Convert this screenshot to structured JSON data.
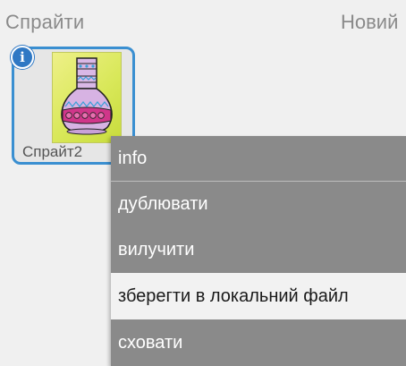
{
  "header": {
    "sprites_label": "Спрайти",
    "new_label": "Новий"
  },
  "sprite": {
    "name": "Спрайт2",
    "info_badge": "i",
    "thumbnail_icon": "vase-icon"
  },
  "context_menu": {
    "items": [
      {
        "label": "info"
      },
      {
        "label": "дублювати"
      },
      {
        "label": "вилучити"
      },
      {
        "label": "зберегти в локальний файл",
        "highlighted": true
      },
      {
        "label": "сховати"
      }
    ]
  },
  "colors": {
    "accent": "#3a8fd1",
    "menu_background": "#8a8a8a",
    "menu_highlight": "#f2f2f2"
  }
}
